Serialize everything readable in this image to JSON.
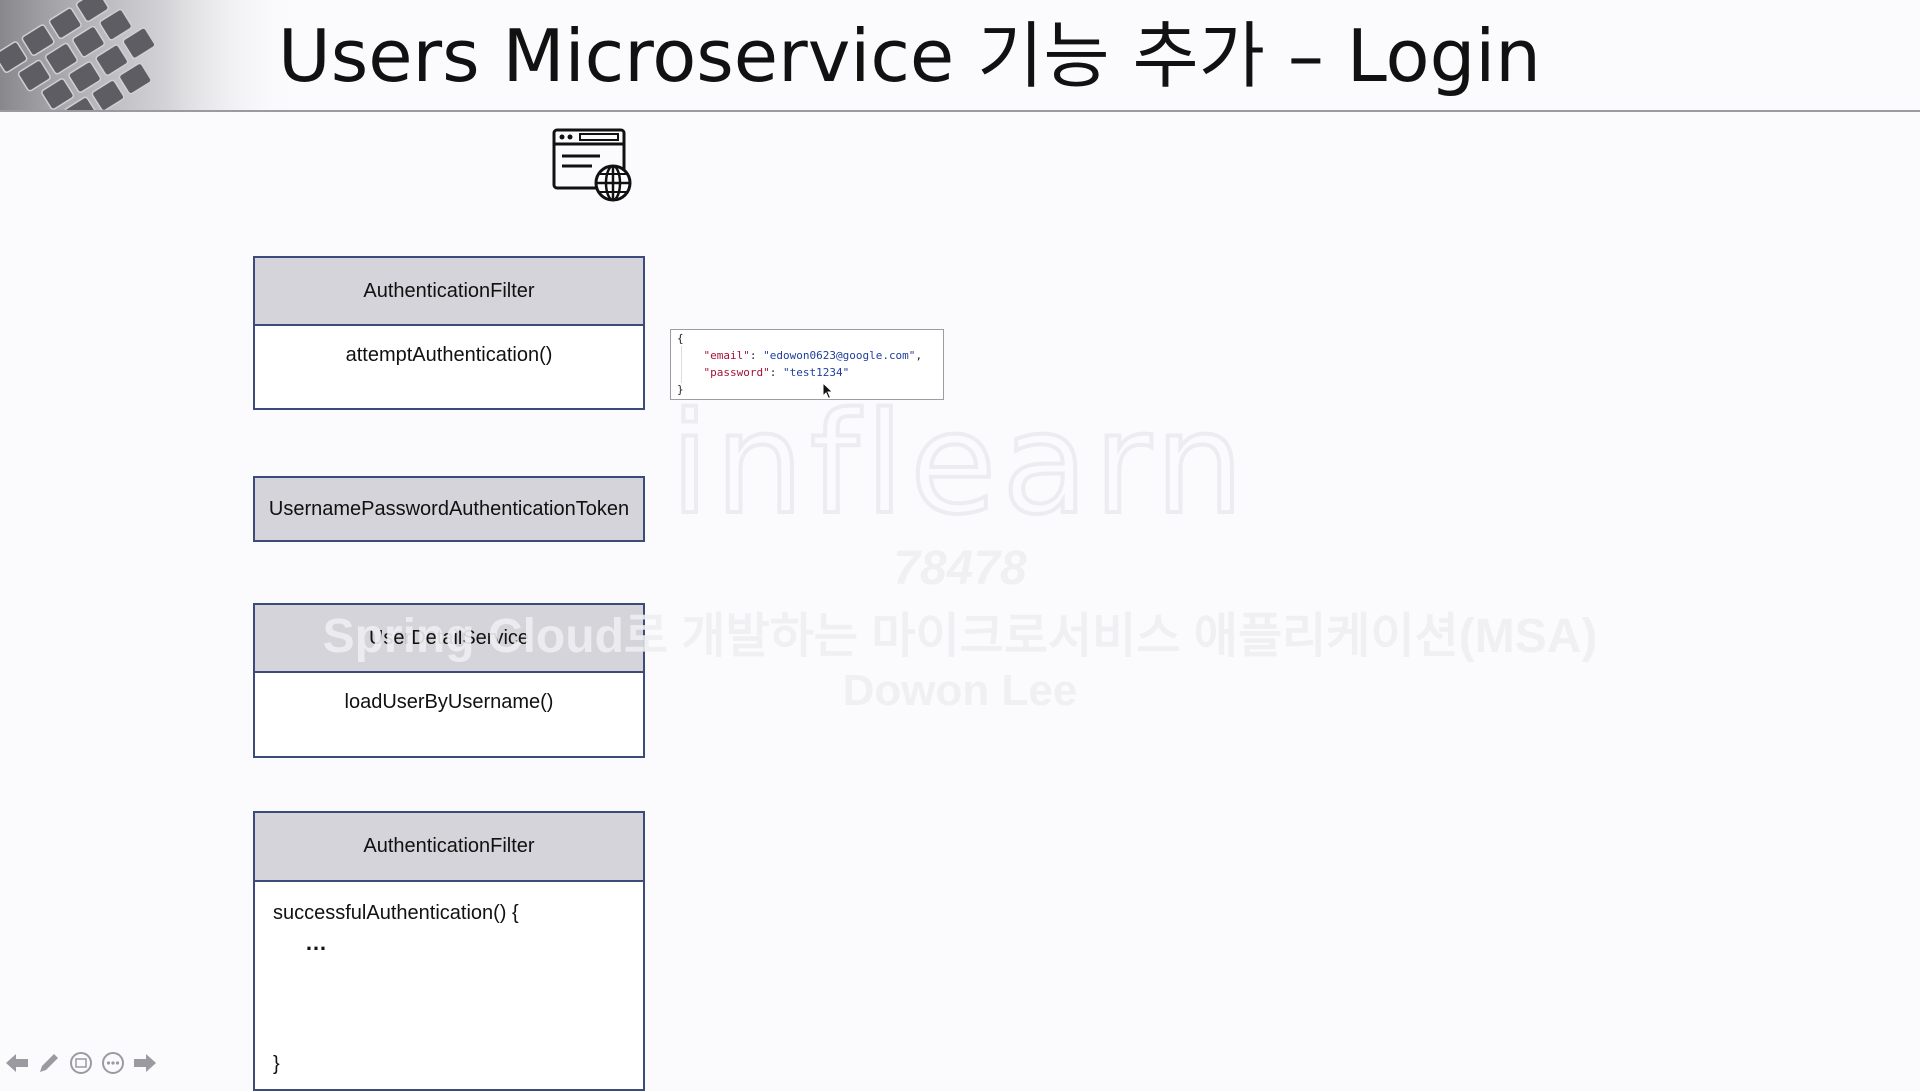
{
  "slide": {
    "title": "Users Microservice 기능 추가 – Login"
  },
  "diagram": {
    "auth_filter_top": {
      "class_name": "AuthenticationFilter",
      "method": "attemptAuthentication()"
    },
    "token": {
      "class_name": "UsernamePasswordAuthenticationToken"
    },
    "user_detail_service": {
      "class_name": "UserDetailService",
      "method": "loadUserByUsername()"
    },
    "auth_filter_bottom": {
      "class_name": "AuthenticationFilter",
      "method_open": "successfulAuthentication() {",
      "ellipsis": "…",
      "method_close": "}"
    }
  },
  "request_json": {
    "open": "{",
    "email_key": "\"email\"",
    "email_value": "\"edowon0623@google.com\"",
    "password_key": "\"password\"",
    "password_value": "\"test1234\"",
    "close": "}"
  },
  "watermark": {
    "logo": "inflearn",
    "id": "78478",
    "course": "Spring Cloud로 개발하는 마이크로서비스 애플리케이션(MSA)",
    "author": "Dowon Lee"
  },
  "toolbar": {
    "icons": [
      "arrow-left-icon",
      "pen-icon",
      "slides-icon",
      "more-icon",
      "arrow-right-icon"
    ]
  }
}
